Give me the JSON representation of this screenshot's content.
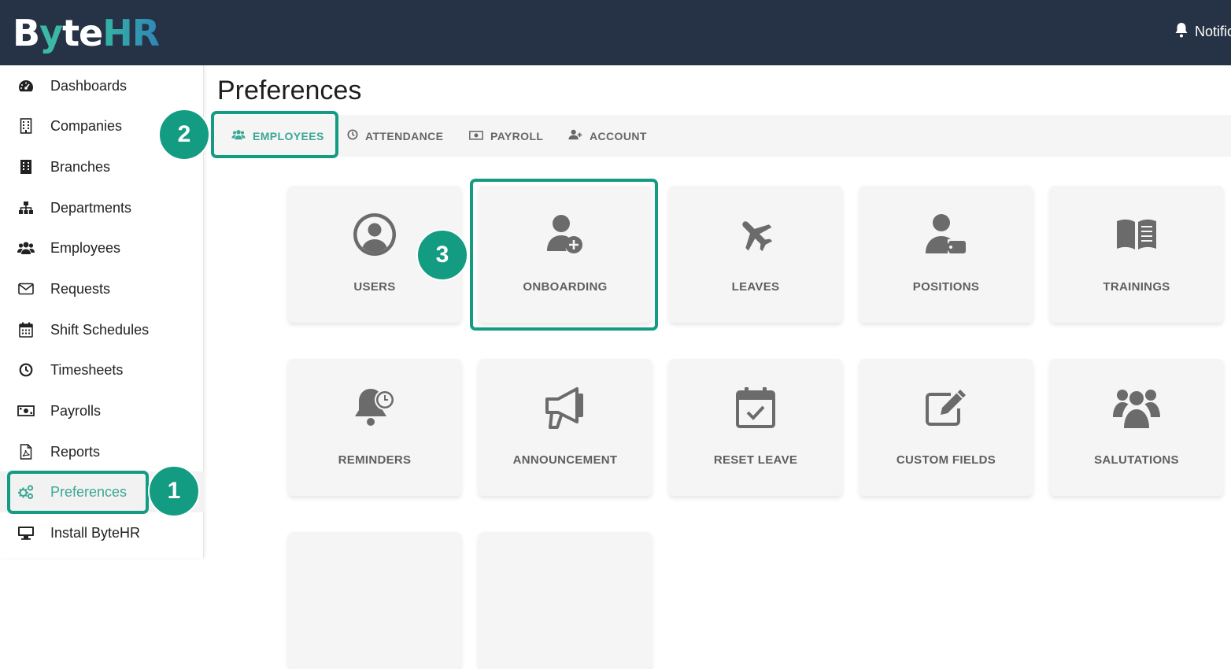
{
  "header": {
    "logo_prefix": "B",
    "logo_y": "y",
    "logo_te": "te",
    "logo_hr": "HR",
    "notifications_label": "Notific"
  },
  "sidebar": {
    "items": [
      {
        "label": "Dashboards",
        "icon": "tachometer-icon"
      },
      {
        "label": "Companies",
        "icon": "building-icon"
      },
      {
        "label": "Branches",
        "icon": "office-building-icon"
      },
      {
        "label": "Departments",
        "icon": "sitemap-icon"
      },
      {
        "label": "Employees",
        "icon": "users-icon"
      },
      {
        "label": "Requests",
        "icon": "envelope-icon"
      },
      {
        "label": "Shift Schedules",
        "icon": "calendar-icon"
      },
      {
        "label": "Timesheets",
        "icon": "clock-icon"
      },
      {
        "label": "Payrolls",
        "icon": "money-bill-icon"
      },
      {
        "label": "Reports",
        "icon": "pdf-file-icon"
      },
      {
        "label": "Preferences",
        "icon": "cogs-icon",
        "active": true
      },
      {
        "label": "Install ByteHR",
        "icon": "desktop-icon"
      }
    ]
  },
  "main": {
    "title": "Preferences",
    "tabs": [
      {
        "label": "EMPLOYEES",
        "icon": "users-icon",
        "active": true
      },
      {
        "label": "ATTENDANCE",
        "icon": "clock-icon"
      },
      {
        "label": "PAYROLL",
        "icon": "money-bill-icon"
      },
      {
        "label": "ACCOUNT",
        "icon": "user-plus-icon"
      }
    ],
    "tiles": [
      {
        "label": "USERS",
        "icon": "user-circle-icon"
      },
      {
        "label": "ONBOARDING",
        "icon": "user-plus-icon"
      },
      {
        "label": "LEAVES",
        "icon": "plane-icon"
      },
      {
        "label": "POSITIONS",
        "icon": "user-tag-icon"
      },
      {
        "label": "TRAININGS",
        "icon": "book-open-icon"
      },
      {
        "label": "REMINDERS",
        "icon": "bell-clock-icon"
      },
      {
        "label": "ANNOUNCEMENT",
        "icon": "megaphone-icon"
      },
      {
        "label": "RESET LEAVE",
        "icon": "calendar-check-icon"
      },
      {
        "label": "CUSTOM FIELDS",
        "icon": "edit-icon"
      },
      {
        "label": "SALUTATIONS",
        "icon": "users-icon"
      }
    ]
  },
  "annotations": {
    "step1": "1",
    "step2": "2",
    "step3": "3"
  },
  "colors": {
    "topbar": "#263245",
    "accent": "#3aa894",
    "annotation": "#149c83",
    "tile_bg": "#f5f5f5",
    "icon_gray": "#6b6b6b"
  }
}
